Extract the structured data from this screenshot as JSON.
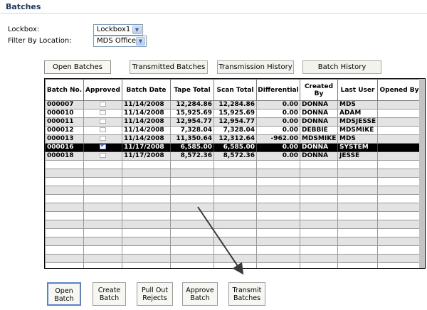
{
  "page": {
    "title": "Batches"
  },
  "filters": {
    "lockbox": {
      "label": "Lockbox:",
      "value": "Lockbox1"
    },
    "location": {
      "label": "Filter By Location:",
      "value": "MDS Office"
    }
  },
  "tabs": [
    {
      "label": "Open Batches",
      "active": true
    },
    {
      "label": "Transmitted Batches",
      "active": false
    },
    {
      "label": "Transmission History",
      "active": false
    },
    {
      "label": "Batch History",
      "active": false
    }
  ],
  "table": {
    "columns": [
      "Batch No.",
      "Approved",
      "Batch Date",
      "Tape Total",
      "Scan Total",
      "Differential",
      "Created By",
      "Last User",
      "Opened By"
    ],
    "rows": [
      {
        "batch_no": "000007",
        "approved": false,
        "date": "11/14/2008",
        "tape": "12,284.86",
        "scan": "12,284.86",
        "diff": "0.00",
        "created": "DONNA",
        "last_user": "MDS",
        "opened": ""
      },
      {
        "batch_no": "000010",
        "approved": false,
        "date": "11/14/2008",
        "tape": "15,925.69",
        "scan": "15,925.69",
        "diff": "0.00",
        "created": "DONNA",
        "last_user": "ADAM",
        "opened": ""
      },
      {
        "batch_no": "000011",
        "approved": false,
        "date": "11/14/2008",
        "tape": "12,954.77",
        "scan": "12,954.77",
        "diff": "0.00",
        "created": "DONNA",
        "last_user": "MDSJESSE",
        "opened": ""
      },
      {
        "batch_no": "000012",
        "approved": false,
        "date": "11/14/2008",
        "tape": "7,328.04",
        "scan": "7,328.04",
        "diff": "0.00",
        "created": "DEBBIE",
        "last_user": "MDSMIKE",
        "opened": ""
      },
      {
        "batch_no": "000013",
        "approved": false,
        "date": "11/14/2008",
        "tape": "11,350.64",
        "scan": "12,312.64",
        "diff": "-962.00",
        "created": "MDSMIKE",
        "last_user": "MDS",
        "opened": ""
      },
      {
        "batch_no": "000016",
        "approved": true,
        "date": "11/17/2008",
        "tape": "6,585.00",
        "scan": "6,585.00",
        "diff": "0.00",
        "created": "DONNA",
        "last_user": "SYSTEM",
        "opened": ""
      },
      {
        "batch_no": "000018",
        "approved": false,
        "date": "11/17/2008",
        "tape": "8,572.36",
        "scan": "8,572.36",
        "diff": "0.00",
        "created": "DONNA",
        "last_user": "JESSE",
        "opened": ""
      }
    ],
    "selected_row": 5,
    "empty_rows": 13
  },
  "buttons": [
    {
      "line1": "Open",
      "line2": "Batch"
    },
    {
      "line1": "Create",
      "line2": "Batch"
    },
    {
      "line1": "Pull Out",
      "line2": "Rejects"
    },
    {
      "line1": "Approve",
      "line2": "Batch"
    },
    {
      "line1": "Transmit",
      "line2": "Batches"
    }
  ],
  "colors": {
    "title": "#1f3a5f",
    "selected_row": "#000000",
    "alt_row": "#e3e3e3",
    "check": "#2e5bd6"
  }
}
